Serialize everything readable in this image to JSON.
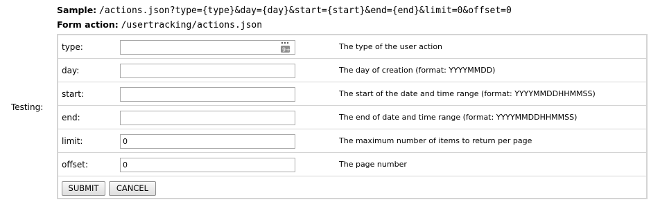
{
  "sample": {
    "label": "Sample:",
    "value": "/actions.json?type={type}&day={day}&start={start}&end={end}&limit=0&offset=0"
  },
  "form_action": {
    "label": "Form action:",
    "value": "/usertracking/actions.json"
  },
  "testing_label": "Testing:",
  "fields": [
    {
      "label": "type:",
      "value": "",
      "description": "The type of the user action",
      "icon": "picker-icon"
    },
    {
      "label": "day:",
      "value": "",
      "description": "The day of creation (format: YYYYMMDD)"
    },
    {
      "label": "start:",
      "value": "",
      "description": "The start of the date and time range (format: YYYYMMDDHHMMSS)"
    },
    {
      "label": "end:",
      "value": "",
      "description": "The end of date and time range (format: YYYYMMDDHHMMSS)"
    },
    {
      "label": "limit:",
      "value": "0",
      "description": "The maximum number of items to return per page"
    },
    {
      "label": "offset:",
      "value": "0",
      "description": "The page number"
    }
  ],
  "buttons": {
    "submit": "SUBMIT",
    "cancel": "CANCEL"
  },
  "colors": {
    "border": "#d4d4d4",
    "input_border": "#a9a9a9"
  }
}
